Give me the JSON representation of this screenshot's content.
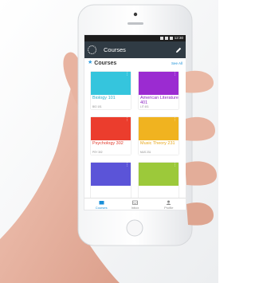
{
  "status_bar": {
    "time": "12:30"
  },
  "app_bar": {
    "title": "Courses",
    "logo_icon": "dotted-circle-logo",
    "action_icon": "pencil-icon"
  },
  "section": {
    "title": "Courses",
    "see_all": "See All"
  },
  "courses": [
    {
      "name": "Biology 101",
      "code": "BIO 101",
      "color": "#35c5dd",
      "name_color": "#2aaecb"
    },
    {
      "name": "American Literature 401",
      "code": "LIT 401",
      "color": "#9b2bd1",
      "name_color": "#8c23c3"
    },
    {
      "name": "Psychology 302",
      "code": "PSY 302",
      "color": "#eb3d2d",
      "name_color": "#e03a2c"
    },
    {
      "name": "Music Theory 231",
      "code": "MUS 231",
      "color": "#f0b320",
      "name_color": "#e8a716"
    },
    {
      "name": "",
      "code": "",
      "color": "#5b54d8",
      "name_color": "#5b54d8"
    },
    {
      "name": "",
      "code": "",
      "color": "#9cc93a",
      "name_color": "#8fbb2e"
    }
  ],
  "bottom_nav": [
    {
      "label": "Courses",
      "active": true,
      "icon": "courses-icon"
    },
    {
      "label": "Inbox",
      "active": false,
      "icon": "inbox-icon"
    },
    {
      "label": "Profile",
      "active": false,
      "icon": "profile-icon"
    }
  ]
}
